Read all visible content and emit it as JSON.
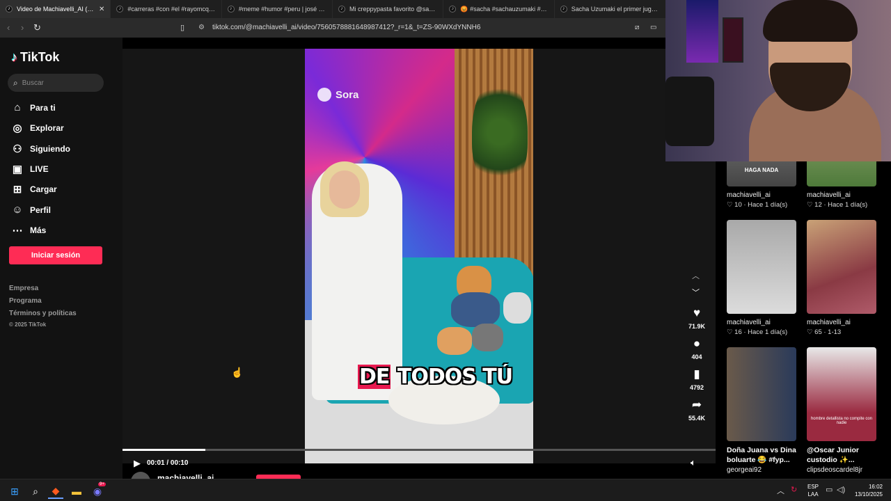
{
  "browser": {
    "tabs": [
      {
        "label": "Video de Machiavelli_AI (@mac",
        "active": true
      },
      {
        "label": "#carreras #con #el #rayomcqueen #",
        "active": false
      },
      {
        "label": "#meme #humor #peru | josé pajer|",
        "active": false
      },
      {
        "label": "Mi creppypasta favorito @sachauzu",
        "active": false
      },
      {
        "label": "😡 #sacha #sachauzumaki #osit",
        "active": false
      },
      {
        "label": "Sacha Uzumaki el primer juguete",
        "active": false
      }
    ],
    "url": "tiktok.com/@machiavelli_ai/video/7560578881648987412?_r=1&_t=ZS-90WXdYNNH6"
  },
  "sidebar": {
    "logo": "TikTok",
    "search_placeholder": "Buscar",
    "nav": [
      {
        "label": "Para ti",
        "icon": "home-icon"
      },
      {
        "label": "Explorar",
        "icon": "compass-icon"
      },
      {
        "label": "Siguiendo",
        "icon": "following-icon"
      },
      {
        "label": "LIVE",
        "icon": "live-icon"
      },
      {
        "label": "Cargar",
        "icon": "upload-icon"
      },
      {
        "label": "Perfil",
        "icon": "profile-icon"
      },
      {
        "label": "Más",
        "icon": "more-icon"
      }
    ],
    "login_label": "Iniciar sesión",
    "footer": [
      "Empresa",
      "Programa",
      "Términos y políticas",
      "© 2025 TikTok"
    ]
  },
  "player": {
    "watermark": "Sora",
    "caption_highlight": "DE",
    "caption_rest": " TODOS TÚ",
    "time": "00:01 / 00:10",
    "progress": 0.14,
    "likes": "71.9K",
    "comments": "404",
    "saves": "4792",
    "shares": "55.4K",
    "author": "machiavelli_ai"
  },
  "related": [
    {
      "thumb_text": "HAGA NADA",
      "user": "machiavelli_ai",
      "meta": "♡ 10 · Hace 1 día(s)",
      "title": ""
    },
    {
      "thumb_text": "",
      "user": "machiavelli_ai",
      "meta": "♡ 12 · Hace 1 día(s)",
      "title": ""
    },
    {
      "thumb_text": "",
      "user": "machiavelli_ai",
      "meta": "♡ 16 · Hace 1 día(s)",
      "title": ""
    },
    {
      "thumb_text": "",
      "user": "machiavelli_ai",
      "meta": "♡ 65 · 1-13",
      "title": ""
    },
    {
      "thumb_text": "",
      "user": "georgeai92",
      "meta": "",
      "title": "Doña Juana vs Dina boluarte 😂 #fyp..."
    },
    {
      "thumb_text": "hombre detallista no compite con nadie",
      "user": "clipsdeoscardel8jr",
      "meta": "",
      "title": "@Oscar Junior custodio ✨..."
    }
  ],
  "taskbar": {
    "lang": "ESP",
    "lang2": "LAA",
    "time": "16:02",
    "date": "13/10/2025",
    "badge": "9+"
  }
}
